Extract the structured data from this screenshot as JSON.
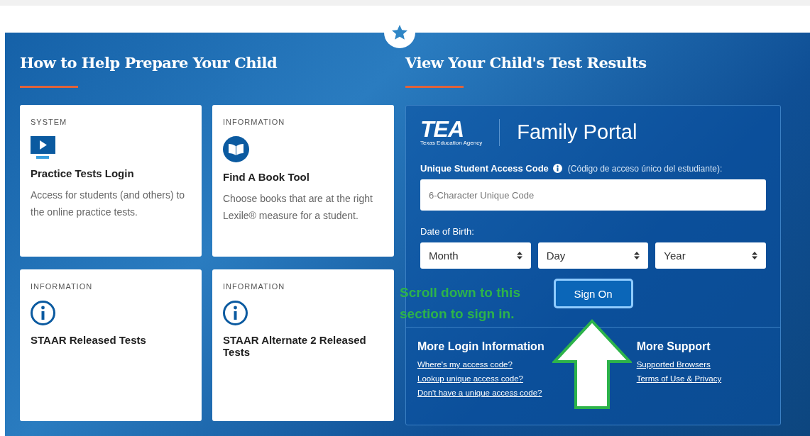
{
  "left_section": {
    "heading": "How to Help Prepare Your Child",
    "cards": [
      {
        "category": "SYSTEM",
        "kind": "monitor",
        "title": "Practice Tests Login",
        "description": "Access for students (and others) to the online practice tests."
      },
      {
        "category": "INFORMATION",
        "kind": "book",
        "title": "Find A Book Tool",
        "description": "Choose books that are at the right Lexile® measure for a student."
      },
      {
        "category": "INFORMATION",
        "kind": "info",
        "title": "STAAR Released Tests"
      },
      {
        "category": "INFORMATION",
        "kind": "info",
        "title": "STAAR Alternate 2 Released Tests"
      }
    ]
  },
  "right_section": {
    "heading": "View Your Child's Test Results",
    "portal": {
      "logo_text": "TEA",
      "logo_subtext": "Texas Education Agency",
      "title": "Family Portal",
      "code_label": "Unique Student Access Code",
      "code_label_spanish": "(Código de acceso único del estudiante):",
      "code_placeholder": "6-Character Unique Code",
      "dob_label": "Date of Birth:",
      "selects": [
        {
          "value": "Month"
        },
        {
          "value": "Day"
        },
        {
          "value": "Year"
        }
      ],
      "sign_on_button": "Sign On",
      "link_groups": [
        {
          "heading": "More Login Information",
          "links": [
            "Where's my access code?",
            "Lookup unique access code?",
            "Don't have a unique access code?"
          ]
        },
        {
          "heading": "More Support",
          "links": [
            "Supported Browsers",
            "Terms of Use & Privacy"
          ]
        }
      ]
    }
  },
  "annotation": {
    "text": "Scroll down to this section to sign in."
  }
}
